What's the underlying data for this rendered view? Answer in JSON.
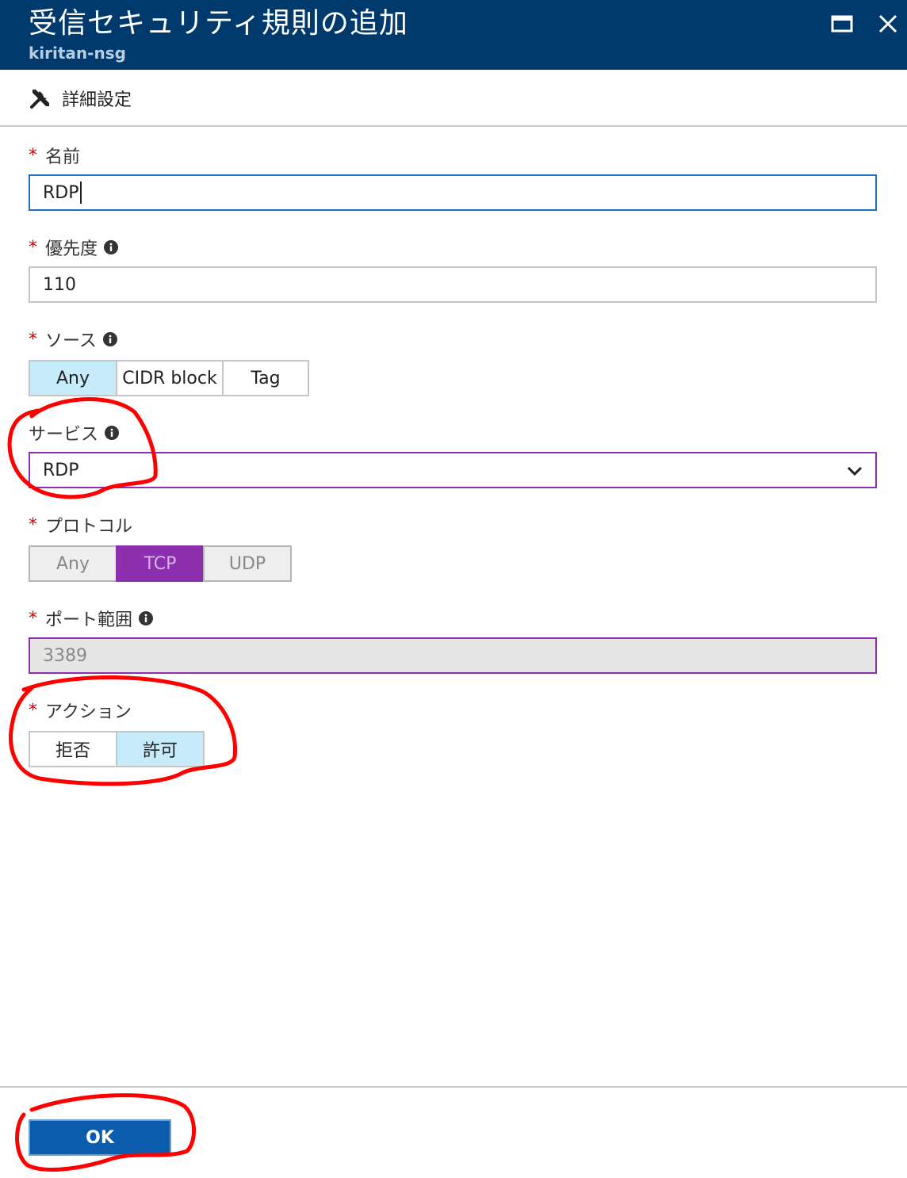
{
  "header": {
    "title": "受信セキュリティ規則の追加",
    "subtitle": "kiritan-nsg",
    "maximize_icon": "maximize-icon",
    "close_icon": "close-icon"
  },
  "toolbar": {
    "advanced_label": "詳細設定",
    "advanced_icon": "tools-icon"
  },
  "form": {
    "required_mark": "*",
    "name": {
      "label": "名前",
      "value": "RDP"
    },
    "priority": {
      "label": "優先度",
      "value": "110"
    },
    "source": {
      "label": "ソース",
      "options": [
        "Any",
        "CIDR block",
        "Tag"
      ],
      "selected": "Any"
    },
    "service": {
      "label": "サービス",
      "value": "RDP"
    },
    "protocol": {
      "label": "プロトコル",
      "options": [
        "Any",
        "TCP",
        "UDP"
      ],
      "selected": "TCP"
    },
    "port_range": {
      "label": "ポート範囲",
      "value": "3389"
    },
    "action": {
      "label": "アクション",
      "options": [
        "拒否",
        "許可"
      ],
      "selected": "許可"
    }
  },
  "footer": {
    "ok_label": "OK"
  },
  "colors": {
    "header_bg": "#003a6c",
    "selected_blue": "#c6ecfb",
    "selected_purple": "#8b2fae",
    "ok_button": "#0b5cad",
    "annotation": "#ff0000"
  }
}
